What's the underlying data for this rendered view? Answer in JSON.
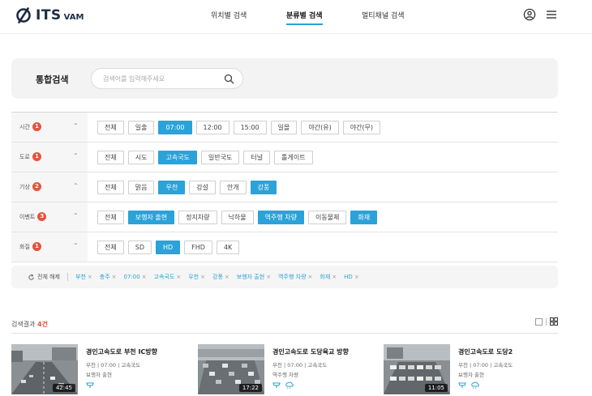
{
  "header": {
    "logo_its": "ITS",
    "logo_vam": "VAM",
    "nav": [
      "위치별 검색",
      "분류별 검색",
      "멀티채널 검색"
    ],
    "active_nav": "분류별 검색"
  },
  "search": {
    "title": "통합검색",
    "placeholder": "검색어를 입력해주세요"
  },
  "filters": [
    {
      "label": "시간",
      "count": "1",
      "options": [
        "전체",
        "일출",
        "07:00",
        "12:00",
        "15:00",
        "일몰",
        "야간(유)",
        "야간(무)"
      ],
      "selected": [
        "07:00"
      ]
    },
    {
      "label": "도로",
      "count": "1",
      "options": [
        "전체",
        "시도",
        "고속국도",
        "일반국도",
        "터널",
        "톨게이트"
      ],
      "selected": [
        "고속국도"
      ]
    },
    {
      "label": "기상",
      "count": "2",
      "options": [
        "전체",
        "맑음",
        "우천",
        "강설",
        "안개",
        "강풍"
      ],
      "selected": [
        "우천",
        "강풍"
      ]
    },
    {
      "label": "이벤트",
      "count": "3",
      "options": [
        "전체",
        "보행자 출현",
        "정지차량",
        "낙하물",
        "역주행 차량",
        "이동물체",
        "화재"
      ],
      "selected": [
        "보행자 출현",
        "역주행 차량",
        "화재"
      ]
    },
    {
      "label": "화질",
      "count": "1",
      "options": [
        "전체",
        "SD",
        "HD",
        "FHD",
        "4K"
      ],
      "selected": [
        "HD"
      ]
    }
  ],
  "applied": {
    "reset_label": "전체 해제",
    "tags": [
      "부천",
      "충주",
      "07:00",
      "고속국도",
      "우천",
      "강풍",
      "보행자 출현",
      "역주행 차량",
      "화재",
      "HD"
    ]
  },
  "results": {
    "label": "검색결과",
    "count": "4건",
    "items": [
      {
        "title": "경인고속도로 부천 IC방향",
        "meta": "부천 | 07:00 | 고속국도",
        "event": "보행자 출현",
        "duration": "42:45"
      },
      {
        "title": "경인고속도로 도당육교 방향",
        "meta": "부천 | 07:00 | 고속국도",
        "event": "역주행 차량",
        "duration": "17:22"
      },
      {
        "title": "경인고속도로 도당2",
        "meta": "부천 | 07:00 | 고속국도",
        "event": "보행자 출현",
        "duration": "11:05"
      }
    ]
  },
  "colors": {
    "accent": "#2ba2d8",
    "badge": "#e5533d",
    "logo": "#1f2a44"
  }
}
